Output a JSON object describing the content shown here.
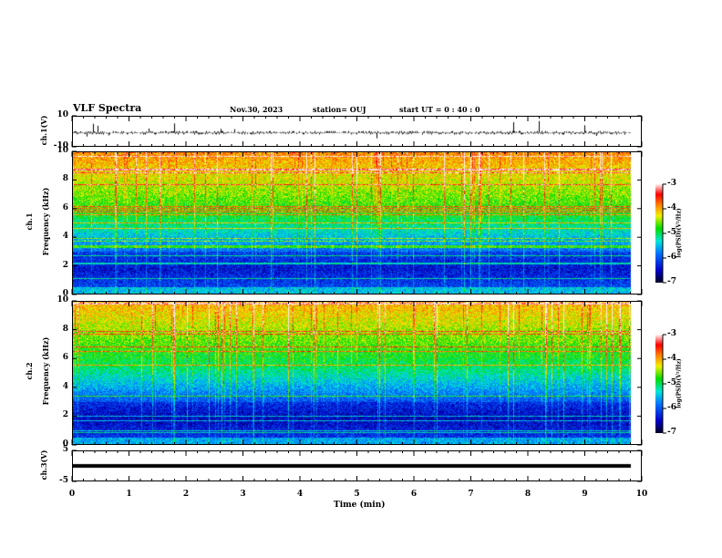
{
  "header": {
    "title": "VLF Spectra",
    "date": "Nov.30, 2023",
    "station": "station= OUJ",
    "start": "start  UT  =   0 : 40 : 0"
  },
  "chart_data": [
    {
      "type": "line",
      "name": "ch1",
      "ylabel": "ch.1(V)",
      "ylim": [
        -10,
        10
      ],
      "yticks": [
        "10",
        "-10"
      ],
      "xlim": [
        0,
        10
      ],
      "x_data_end": 9.83,
      "baseline": -2
    },
    {
      "type": "heatmap",
      "ylabel_top": "ch.1",
      "ylabel": "Frequency  (kHz)",
      "ylim": [
        0,
        10
      ],
      "yticks": [
        "0",
        "2",
        "4",
        "6",
        "8",
        "10"
      ],
      "xlim": [
        0,
        10
      ],
      "x_data_end": 9.83,
      "colorbar": {
        "label": "log(PSD)(V²/Hz)",
        "range": [
          -7,
          -3
        ],
        "ticks": [
          "-3",
          "-4",
          "-5",
          "-6",
          "-7"
        ]
      }
    },
    {
      "type": "heatmap",
      "ylabel_top": "ch.2",
      "ylabel": "Frequency  (kHz)",
      "ylim": [
        0,
        10
      ],
      "yticks": [
        "0",
        "2",
        "4",
        "6",
        "8",
        "10"
      ],
      "xlim": [
        0,
        10
      ],
      "x_data_end": 9.83,
      "colorbar": {
        "label": "log(PSD)(V²/Hz)",
        "range": [
          -7,
          -3
        ],
        "ticks": [
          "-3",
          "-4",
          "-5",
          "-6",
          "-7"
        ]
      }
    },
    {
      "type": "line",
      "name": "ch3",
      "ylabel": "ch.3(V)",
      "ylim": [
        -5,
        5
      ],
      "yticks": [
        "5",
        "-5"
      ],
      "xlim": [
        0,
        10
      ],
      "x_data_end": 9.83,
      "constant_value": 0
    }
  ],
  "xaxis": {
    "label": "Time  (min)",
    "ticks": [
      "0",
      "1",
      "2",
      "3",
      "4",
      "5",
      "6",
      "7",
      "8",
      "9",
      "10"
    ]
  }
}
